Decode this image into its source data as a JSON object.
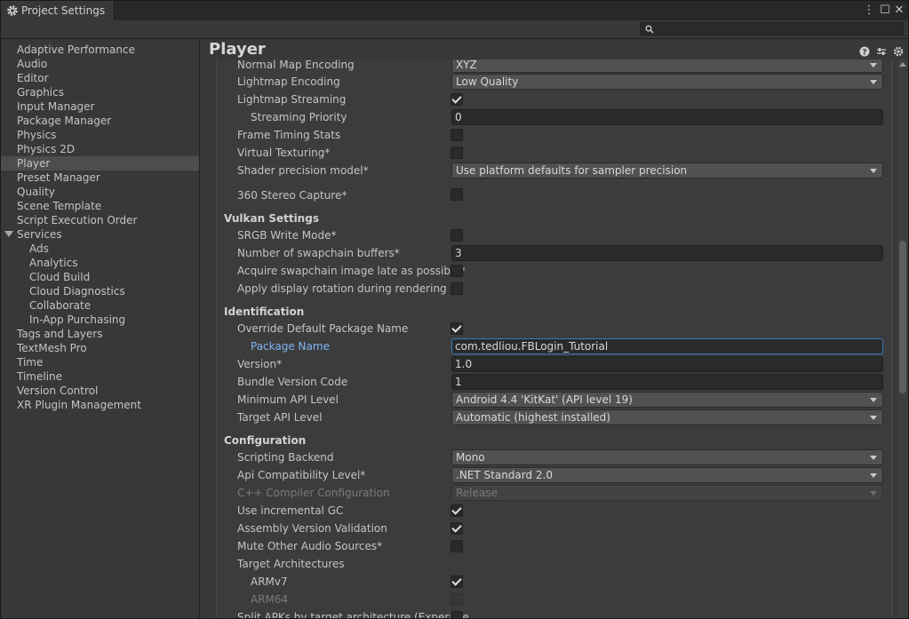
{
  "window": {
    "title": "Project Settings",
    "menu_glyph": "⋮",
    "maximize_glyph": "☐",
    "close_glyph": "✕"
  },
  "search": {
    "placeholder": "",
    "value": ""
  },
  "sidebar": {
    "items": [
      {
        "label": "Adaptive Performance"
      },
      {
        "label": "Audio"
      },
      {
        "label": "Editor"
      },
      {
        "label": "Graphics"
      },
      {
        "label": "Input Manager"
      },
      {
        "label": "Package Manager"
      },
      {
        "label": "Physics"
      },
      {
        "label": "Physics 2D"
      },
      {
        "label": "Player",
        "selected": true
      },
      {
        "label": "Preset Manager"
      },
      {
        "label": "Quality"
      },
      {
        "label": "Scene Template"
      },
      {
        "label": "Script Execution Order"
      },
      {
        "label": "Services",
        "expanded": true
      },
      {
        "label": "Ads"
      },
      {
        "label": "Analytics"
      },
      {
        "label": "Cloud Build"
      },
      {
        "label": "Cloud Diagnostics"
      },
      {
        "label": "Collaborate"
      },
      {
        "label": "In-App Purchasing"
      },
      {
        "label": "Tags and Layers"
      },
      {
        "label": "TextMesh Pro"
      },
      {
        "label": "Time"
      },
      {
        "label": "Timeline"
      },
      {
        "label": "Version Control"
      },
      {
        "label": "XR Plugin Management"
      }
    ]
  },
  "page": {
    "title": "Player"
  },
  "settings": {
    "normal_map_encoding": {
      "label": "Normal Map Encoding",
      "value": "XYZ"
    },
    "lightmap_encoding": {
      "label": "Lightmap Encoding",
      "value": "Low Quality"
    },
    "lightmap_streaming": {
      "label": "Lightmap Streaming",
      "checked": true
    },
    "streaming_priority": {
      "label": "Streaming Priority",
      "value": "0"
    },
    "frame_timing_stats": {
      "label": "Frame Timing Stats",
      "checked": false
    },
    "virtual_texturing": {
      "label": "Virtual Texturing*",
      "checked": false
    },
    "shader_precision_model": {
      "label": "Shader precision model*",
      "value": "Use platform defaults for sampler precision"
    },
    "stereo_capture": {
      "label": "360 Stereo Capture*",
      "checked": false
    },
    "vulkan_header": "Vulkan Settings",
    "srgb_write_mode": {
      "label": "SRGB Write Mode*",
      "checked": false
    },
    "swapchain_buffers": {
      "label": "Number of swapchain buffers*",
      "value": "3"
    },
    "acquire_swapchain_late": {
      "label": "Acquire swapchain image late as possible*",
      "checked": false
    },
    "apply_display_rotation": {
      "label": "Apply display rotation during rendering",
      "checked": false
    },
    "identification_header": "Identification",
    "override_package_name": {
      "label": "Override Default Package Name",
      "checked": true
    },
    "package_name": {
      "label": "Package Name",
      "value": "com.tedliou.FBLogin_Tutorial"
    },
    "version": {
      "label": "Version*",
      "value": "1.0"
    },
    "bundle_version_code": {
      "label": "Bundle Version Code",
      "value": "1"
    },
    "minimum_api_level": {
      "label": "Minimum API Level",
      "value": "Android 4.4 'KitKat' (API level 19)"
    },
    "target_api_level": {
      "label": "Target API Level",
      "value": "Automatic (highest installed)"
    },
    "configuration_header": "Configuration",
    "scripting_backend": {
      "label": "Scripting Backend",
      "value": "Mono"
    },
    "api_compatibility": {
      "label": "Api Compatibility Level*",
      "value": ".NET Standard 2.0"
    },
    "cpp_compiler_config": {
      "label": "C++ Compiler Configuration",
      "value": "Release"
    },
    "incremental_gc": {
      "label": "Use incremental GC",
      "checked": true
    },
    "assembly_version_validation": {
      "label": "Assembly Version Validation",
      "checked": true
    },
    "mute_other_audio": {
      "label": "Mute Other Audio Sources*",
      "checked": false
    },
    "target_architectures": {
      "label": "Target Architectures"
    },
    "armv7": {
      "label": "ARMv7",
      "checked": true
    },
    "arm64": {
      "label": "ARM64",
      "checked": false
    },
    "split_apks": {
      "label": "Split APKs by target architecture (Experime",
      "checked": false
    }
  },
  "colors": {
    "background": "#383838",
    "panel": "#3c3c3c",
    "selected": "#4d4d4d",
    "focus_label": "#7fb4f5",
    "focus_border": "#3a79bb"
  },
  "icons": {
    "tab": "gear-icon",
    "search": "search-icon",
    "header": [
      "help-icon",
      "preset-icon",
      "settings-icon"
    ]
  }
}
